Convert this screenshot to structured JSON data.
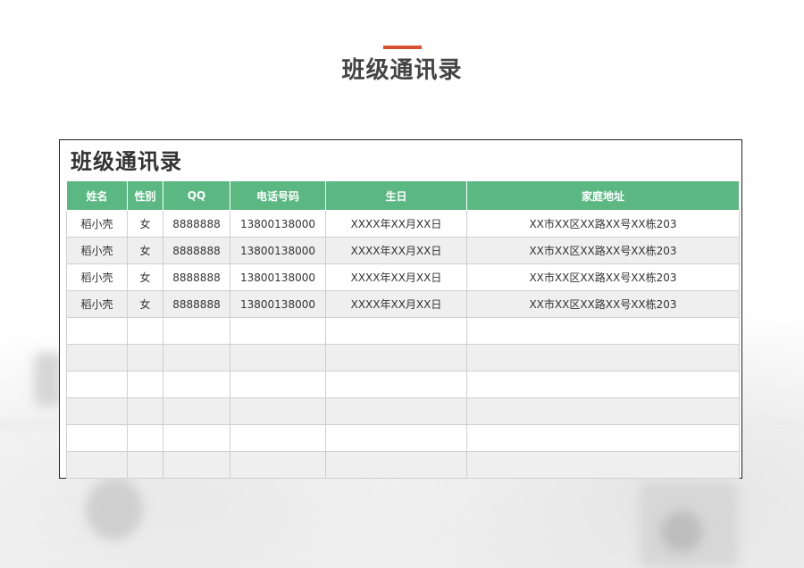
{
  "heading": "班级通讯录",
  "accent_color": "#d9502b",
  "header_color": "#5bb883",
  "document": {
    "title": "班级通讯录",
    "columns": [
      "姓名",
      "性别",
      "QQ",
      "电话号码",
      "生日",
      "家庭地址"
    ],
    "rows": [
      [
        "稻小壳",
        "女",
        "8888888",
        "13800138000",
        "XXXX年XX月XX日",
        "XX市XX区XX路XX号XX栋203"
      ],
      [
        "稻小壳",
        "女",
        "8888888",
        "13800138000",
        "XXXX年XX月XX日",
        "XX市XX区XX路XX号XX栋203"
      ],
      [
        "稻小壳",
        "女",
        "8888888",
        "13800138000",
        "XXXX年XX月XX日",
        "XX市XX区XX路XX号XX栋203"
      ],
      [
        "稻小壳",
        "女",
        "8888888",
        "13800138000",
        "XXXX年XX月XX日",
        "XX市XX区XX路XX号XX栋203"
      ],
      [
        "",
        "",
        "",
        "",
        "",
        ""
      ],
      [
        "",
        "",
        "",
        "",
        "",
        ""
      ],
      [
        "",
        "",
        "",
        "",
        "",
        ""
      ],
      [
        "",
        "",
        "",
        "",
        "",
        ""
      ],
      [
        "",
        "",
        "",
        "",
        "",
        ""
      ],
      [
        "",
        "",
        "",
        "",
        "",
        ""
      ]
    ]
  }
}
